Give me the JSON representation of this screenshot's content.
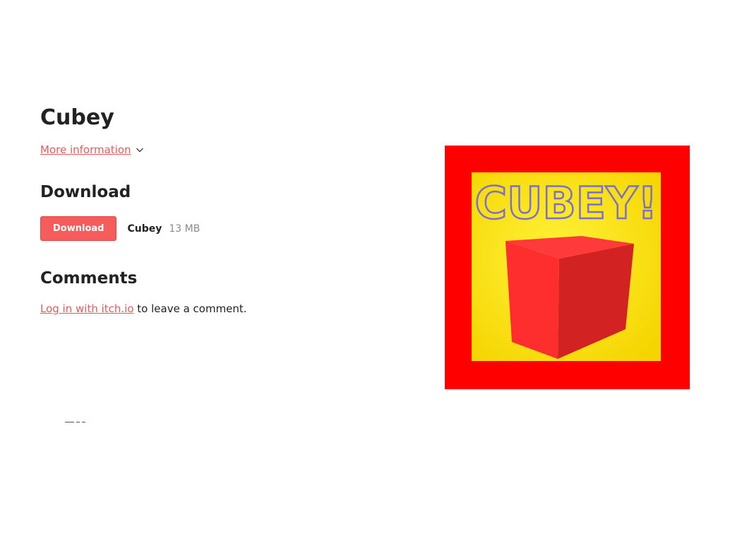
{
  "game": {
    "title": "Cubey",
    "more_info_label": "More information"
  },
  "download": {
    "heading": "Download",
    "button_label": "Download",
    "file_name": "Cubey",
    "file_size": "13 MB"
  },
  "comments": {
    "heading": "Comments",
    "login_link": "Log in with itch.io",
    "login_suffix": " to leave a comment."
  },
  "cover": {
    "logo_text": "CUBEY!",
    "frame_color": "#ff0000",
    "background_color": "#ffe600",
    "cube_color": "#e62828",
    "logo_outline_color": "#7a6fd0"
  },
  "colors": {
    "accent": "#f75c5c",
    "link": "#e85a5a",
    "muted": "#8a8a8a"
  },
  "icons": {
    "more_info_chevron": "chevron-down-icon"
  }
}
